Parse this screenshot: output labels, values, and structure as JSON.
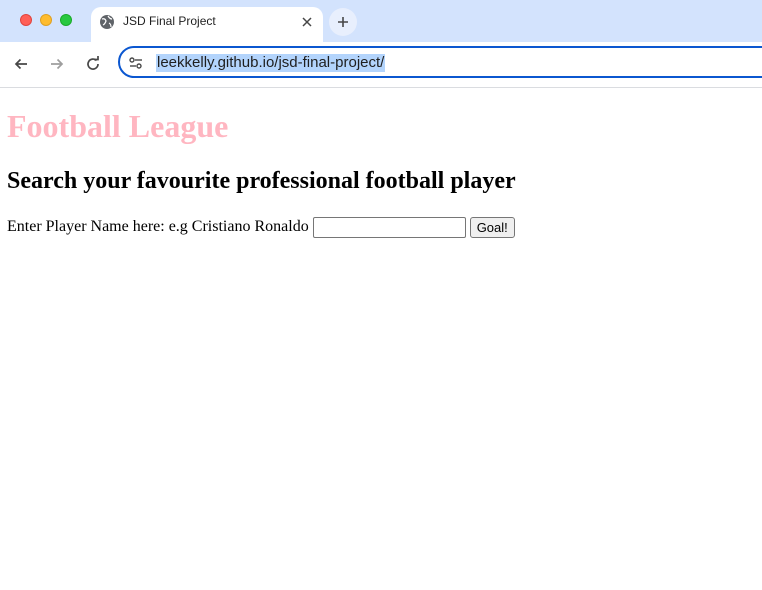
{
  "browser": {
    "tab": {
      "title": "JSD Final Project",
      "icon": "globe-icon"
    },
    "new_tab_symbol": "+",
    "address_bar": {
      "url": "leekkelly.github.io/jsd-final-project/"
    }
  },
  "page": {
    "title": "Football League",
    "title_color": "#ffb6c1",
    "subtitle": "Search your favourite professional football player",
    "search": {
      "label": "Enter Player Name here: e.g Cristiano Ronaldo",
      "input_value": "",
      "button_label": "Goal!"
    }
  }
}
